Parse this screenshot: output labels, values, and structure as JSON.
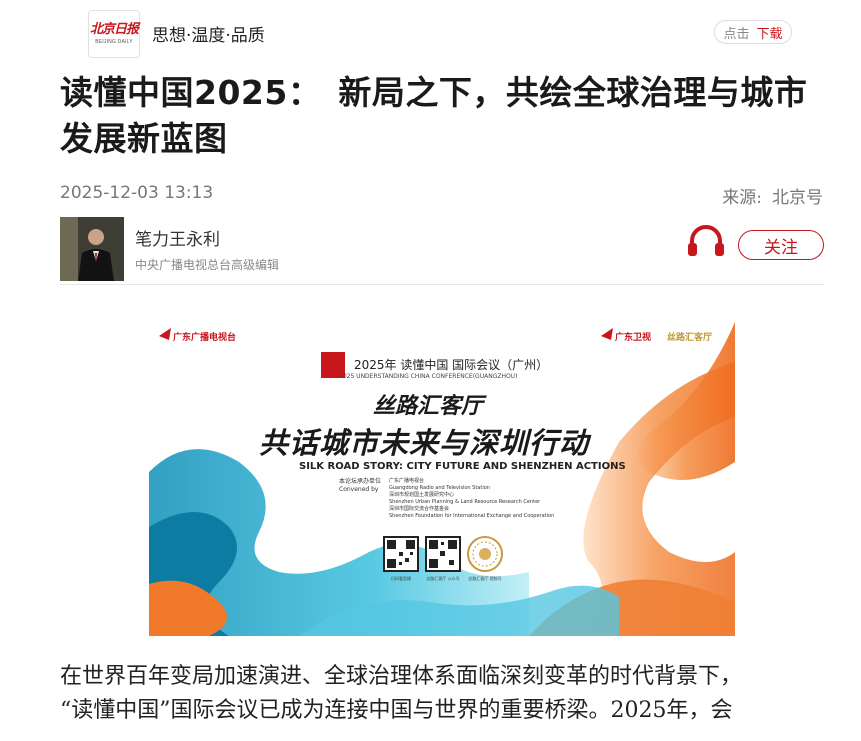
{
  "header": {
    "logo_cn": "北京日报",
    "logo_en": "BEIJING DAILY",
    "slogan": "思想·温度·品质",
    "download_prefix": "点击",
    "download_label": "下载"
  },
  "article": {
    "title": "读懂中国2025：　新局之下，共绘全球治理与城市发展新蓝图",
    "date": "2025-12-03  13:13",
    "source_label": "来源:",
    "source_name": "北京号"
  },
  "author": {
    "name": "笔力王永利",
    "role": "中央广播电视总台高级编辑",
    "follow_label": "关注"
  },
  "poster": {
    "org_left": "广东广播电视台",
    "org_right": "广东卫视",
    "org_right2": "丝路汇客厅",
    "conference": "2025年 读懂中国 国际会议（广州）",
    "conference_en": "2025 UNDERSTANDING CHINA CONFERENCE(GUANGZHOU)",
    "heading1": "丝路汇客厅",
    "heading2": "共话城市未来与深圳行动",
    "heading_en": "SILK ROAD STORY: CITY FUTURE AND SHENZHEN ACTIONS",
    "convened_cn": "本论坛承办单位",
    "convened_en": "Convened by",
    "conveners": [
      "广东广播电视台",
      "Guangdong Radio and Television Station",
      "深圳市规划国土发展研究中心",
      "Shenzhen Urban Planning & Land Resource Research Center",
      "深圳市国际交流合作基金会",
      "Shenzhen Foundation for International Exchange and Cooperation"
    ],
    "qr_labels": [
      "扫码看直播",
      "丝路汇客厅 公众号",
      "丝路汇客厅 视频号"
    ]
  },
  "body": {
    "line1": "在世界百年变局加速演进、全球治理体系面临深刻变革的时代背景下，",
    "line2": "“读懂中国”国际会议已成为连接中国与世界的重要桥梁。2025年，会"
  },
  "colors": {
    "brand_red": "#c8161d",
    "wave_orange": "#f07a2a",
    "wave_blue": "#1aa6c9"
  }
}
